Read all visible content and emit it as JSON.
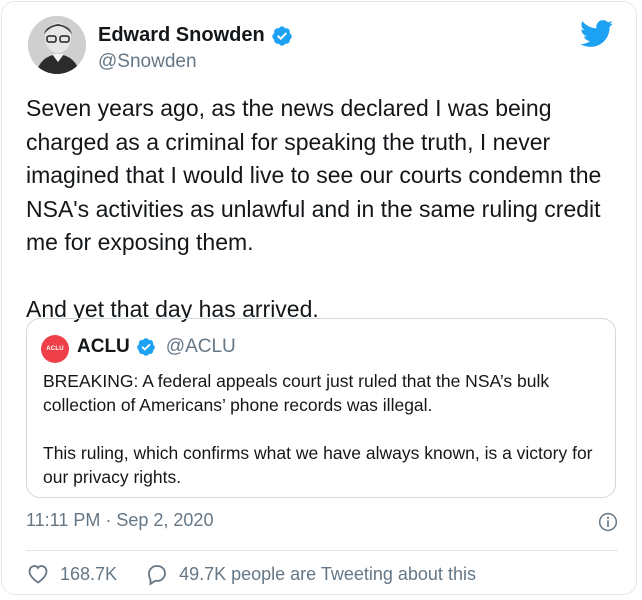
{
  "author": {
    "display_name": "Edward Snowden",
    "handle": "@Snowden",
    "verified": true
  },
  "tweet": {
    "text": "Seven years ago, as the news declared I was being charged as a criminal for speaking the truth, I never imagined that I would live to see our courts condemn the NSA's activities as unlawful and in the same ruling credit me for exposing them.\n\nAnd yet that day has arrived."
  },
  "quoted_tweet": {
    "avatar_text": "ACLU",
    "display_name": "ACLU",
    "handle": "@ACLU",
    "verified": true,
    "paragraph_1": "BREAKING: A federal appeals court just ruled that the NSA’s bulk collection of Americans’ phone records was illegal.",
    "paragraph_2": "This ruling, which confirms what we have always known, is a victory for our privacy rights."
  },
  "meta": {
    "timestamp": "11:11 PM · Sep 2, 2020"
  },
  "actions": {
    "like_count": "168.7K",
    "conversation_text": "49.7K people are Tweeting about this"
  },
  "colors": {
    "twitter_blue": "#1da1f2",
    "aclu_red": "#ef404a",
    "secondary_text": "#657786"
  },
  "icons": [
    "verified-badge-icon",
    "twitter-bird-icon",
    "info-icon",
    "heart-icon",
    "speech-bubble-icon"
  ]
}
